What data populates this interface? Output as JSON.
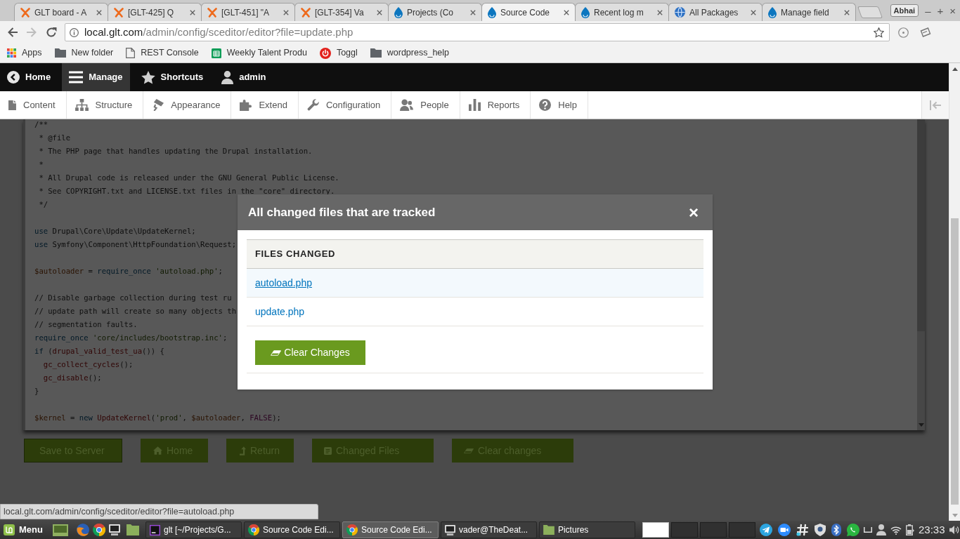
{
  "browser": {
    "tabs": [
      {
        "title": "GLT board - A",
        "kind": "figure",
        "selected": false
      },
      {
        "title": "[GLT-425] Q",
        "kind": "figure",
        "selected": false
      },
      {
        "title": "[GLT-451] \"A",
        "kind": "figure",
        "selected": false
      },
      {
        "title": "[GLT-354] Va",
        "kind": "figure",
        "selected": false
      },
      {
        "title": "Projects (Co",
        "kind": "drop",
        "selected": false
      },
      {
        "title": "Source Code",
        "kind": "drop",
        "selected": true
      },
      {
        "title": "Recent log m",
        "kind": "drop",
        "selected": false
      },
      {
        "title": "All Packages",
        "kind": "globe",
        "selected": false
      },
      {
        "title": "Manage field",
        "kind": "drop",
        "selected": false
      }
    ],
    "profile": "Abhai",
    "window_controls": [
      "–",
      "+",
      "×"
    ],
    "back": {
      "disabled": false
    },
    "forward": {
      "disabled": true
    },
    "address": {
      "host": "local.glt.com",
      "path": "/admin/config/sceditor/editor?file=update.php"
    },
    "bookmarks": [
      {
        "label": "Apps",
        "kind": "apps"
      },
      {
        "label": "New folder",
        "kind": "folder"
      },
      {
        "label": "REST Console",
        "kind": "page"
      },
      {
        "label": "Weekly Talent Produ",
        "kind": "sheet"
      },
      {
        "label": "Toggl",
        "kind": "power"
      },
      {
        "label": "wordpress_help",
        "kind": "folder"
      }
    ]
  },
  "admin_toolbar": {
    "items": [
      {
        "label": "Home",
        "kind": "back",
        "selected": false
      },
      {
        "label": "Manage",
        "kind": "menu",
        "selected": true
      },
      {
        "label": "Shortcuts",
        "kind": "star",
        "selected": false
      },
      {
        "label": "admin",
        "kind": "user",
        "selected": false
      }
    ]
  },
  "admin_tray": {
    "items": [
      {
        "label": "Content",
        "kind": "content"
      },
      {
        "label": "Structure",
        "kind": "structure"
      },
      {
        "label": "Appearance",
        "kind": "appearance"
      },
      {
        "label": "Extend",
        "kind": "extend"
      },
      {
        "label": "Configuration",
        "kind": "configuration"
      },
      {
        "label": "People",
        "kind": "people"
      },
      {
        "label": "Reports",
        "kind": "reports"
      },
      {
        "label": "Help",
        "kind": "help"
      }
    ]
  },
  "editor": {
    "blocks": [
      [
        [
          {
            "text": "/**",
            "kind": "comment"
          }
        ],
        [
          {
            "text": " * @file",
            "kind": "comment"
          }
        ],
        [
          {
            "text": " * The PHP page that handles updating the Drupal installation.",
            "kind": "comment"
          }
        ],
        [
          {
            "text": " *",
            "kind": "comment"
          }
        ],
        [
          {
            "text": " * All Drupal code is released under the GNU General Public License.",
            "kind": "comment"
          }
        ],
        [
          {
            "text": " * See COPYRIGHT.txt and LICENSE.txt files in the \"core\" directory.",
            "kind": "comment"
          }
        ],
        [
          {
            "text": " */",
            "kind": "comment"
          }
        ]
      ],
      [
        [
          {
            "text": "use",
            "kind": "kw"
          },
          {
            "text": " Drupal",
            "kind": "plain"
          },
          {
            "text": "\\",
            "kind": "sep"
          },
          {
            "text": "Core",
            "kind": "plain"
          },
          {
            "text": "\\",
            "kind": "sep"
          },
          {
            "text": "Update",
            "kind": "plain"
          },
          {
            "text": "\\",
            "kind": "sep"
          },
          {
            "text": "UpdateKernel",
            "kind": "plain"
          },
          {
            "text": ";",
            "kind": "punct"
          }
        ],
        [
          {
            "text": "use",
            "kind": "kw"
          },
          {
            "text": " Symfony",
            "kind": "plain"
          },
          {
            "text": "\\",
            "kind": "sep"
          },
          {
            "text": "Component",
            "kind": "plain"
          },
          {
            "text": "\\",
            "kind": "sep"
          },
          {
            "text": "HttpFoundation",
            "kind": "plain"
          },
          {
            "text": "\\",
            "kind": "sep"
          },
          {
            "text": "Request",
            "kind": "plain"
          },
          {
            "text": ";",
            "kind": "punct"
          }
        ]
      ],
      [
        [
          {
            "text": "$autoloader",
            "kind": "var"
          },
          {
            "text": " = ",
            "kind": "punct"
          },
          {
            "text": "require_once",
            "kind": "kw"
          },
          {
            "text": " 'autoload.php'",
            "kind": "str"
          },
          {
            "text": ";",
            "kind": "punct"
          }
        ]
      ],
      [
        [
          {
            "text": "// Disable garbage collection during test ru",
            "kind": "comment"
          }
        ],
        [
          {
            "text": "// update path will create so many objects th",
            "kind": "comment"
          }
        ],
        [
          {
            "text": "// segmentation faults.",
            "kind": "comment"
          }
        ],
        [
          {
            "text": "require_once",
            "kind": "kw"
          },
          {
            "text": " 'core/includes/bootstrap.inc'",
            "kind": "str"
          },
          {
            "text": ";",
            "kind": "punct"
          }
        ],
        [
          {
            "text": "if",
            "kind": "kw"
          },
          {
            "text": " (",
            "kind": "punct"
          },
          {
            "text": "drupal_valid_test_ua",
            "kind": "fn"
          },
          {
            "text": "()) {",
            "kind": "punct"
          }
        ],
        [
          {
            "text": "  gc_collect_cycles",
            "kind": "fn"
          },
          {
            "text": "();",
            "kind": "punct"
          }
        ],
        [
          {
            "text": "  gc_disable",
            "kind": "fn"
          },
          {
            "text": "();",
            "kind": "punct"
          }
        ],
        [
          {
            "text": "}",
            "kind": "punct"
          }
        ]
      ],
      [
        [
          {
            "text": "$kernel",
            "kind": "var"
          },
          {
            "text": " = ",
            "kind": "punct"
          },
          {
            "text": "new",
            "kind": "kw"
          },
          {
            "text": " UpdateKernel",
            "kind": "fn"
          },
          {
            "text": "(",
            "kind": "punct"
          },
          {
            "text": "'prod'",
            "kind": "str"
          },
          {
            "text": ", ",
            "kind": "punct"
          },
          {
            "text": "$autoloader",
            "kind": "var"
          },
          {
            "text": ", ",
            "kind": "punct"
          },
          {
            "text": "FALSE",
            "kind": "const"
          },
          {
            "text": ");",
            "kind": "punct"
          }
        ]
      ]
    ]
  },
  "actions": [
    {
      "label": "Save to Server",
      "kind": "save"
    },
    {
      "label": "Home",
      "kind": "home"
    },
    {
      "label": "Return",
      "kind": "return"
    },
    {
      "label": "Changed Files",
      "kind": "files"
    },
    {
      "label": "Clear changes",
      "kind": "eraser"
    }
  ],
  "dialog": {
    "title": "All changed files that are tracked",
    "close": "×",
    "column": "FILES CHANGED",
    "files": [
      {
        "name": "autoload.php",
        "hovered": true
      },
      {
        "name": "update.php",
        "hovered": false
      }
    ],
    "button": "Clear Changes"
  },
  "status_url": "local.glt.com/admin/config/sceditor/editor?file=autoload.php",
  "taskbar": {
    "menu": "Menu",
    "windows": [
      {
        "label": "glt [~/Projects/G...",
        "kind": "ide",
        "selected": false
      },
      {
        "label": "Source Code Edi...",
        "kind": "chrome",
        "selected": false
      },
      {
        "label": "Source Code Edi...",
        "kind": "chrome",
        "selected": true
      },
      {
        "label": "vader@TheDeat...",
        "kind": "terminal",
        "selected": false
      },
      {
        "label": "Pictures",
        "kind": "folder",
        "selected": false
      }
    ],
    "workspaces": [
      {
        "selected": true
      },
      {
        "selected": false
      },
      {
        "selected": false
      },
      {
        "selected": false
      }
    ],
    "clock": "23:33"
  }
}
